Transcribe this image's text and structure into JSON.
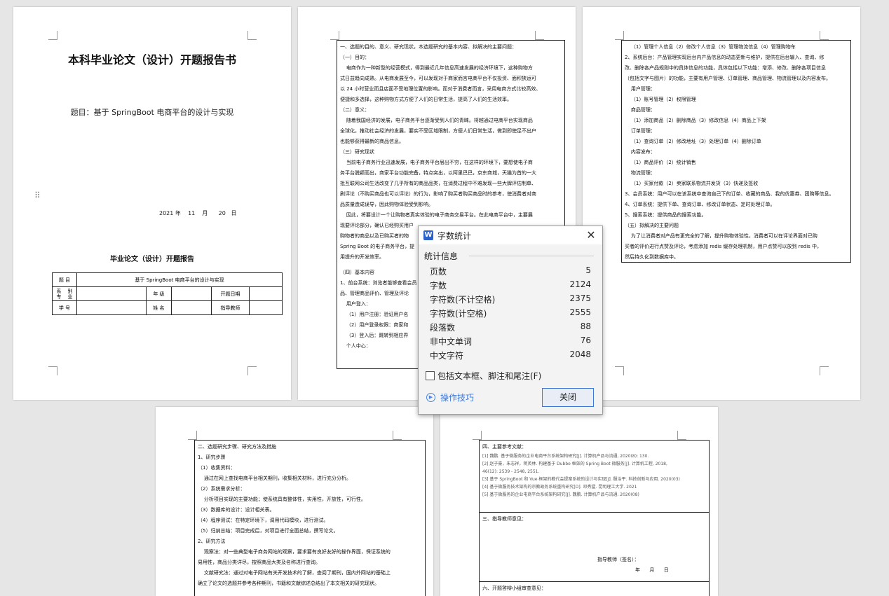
{
  "page1": {
    "title": "本科毕业论文（设计）开题报告书",
    "topic": "题目：基于 SpringBoot 电商平台的设计与实现",
    "date": "2021 年    11    月      20   日",
    "form_title": "毕业论文（设计）开题报告",
    "table": {
      "row1_label": "题    目",
      "row1_value": "基于 SpringBoot 电商平台的设计与实现",
      "row2": [
        "系    别\n专    业",
        "",
        "年    级",
        "",
        "开题日期",
        ""
      ],
      "row3": [
        "学    号",
        "",
        "姓    名",
        "",
        "指导教师",
        ""
      ]
    }
  },
  "page2": {
    "lines": [
      "一、选题的目的、意义、研究现状，本选题研究的基本内容、拟解决的主要问题：",
      "（一）目的：",
      "    电商作为一种新型的经营模式，得到最近几年信息高速发展的经济环境下，这种购物方",
      "式日益趋向成熟。从电商发展至今，可以发现对于商家而言电商平台不仅投资、面积狭运可",
      "以 24 小时营业而且店面不受地理位置的影响。而对于消费者而言，采用电商方式比较高效、",
      "便捷和多选择，这种购物方式方便了人们的日常生活，提高了人们的生活效率。",
      "（二）意义：",
      "    随着我国经济的发展，电子商务平台逐渐受到人们的青睐。将越通过电商平台实现商品",
      "全球化，推动社会经济的发展，要实不受区域限制，方便人们日常生活，做到即使足不出户",
      "也能够获得最新的商品信息。",
      "（三）研究现状",
      "    当前电子商务行业迅速发展，电子商务平台层出不穷，在这样的环境下，要想使电子商",
      "务平台脱颖而出，商家平台功能完备，特点突出，以阿里巴巴，京东商城，天猫为首的一大",
      "批互联网公司生活改变了几乎所有的商品品类，在消费过程中不难发现一些大牌评估制单、",
      "刷评论（不购买商品也可以评论）的行为，影响了购买者购买商品时的参考，使消费者对商",
      "品质量造成误导，因此购物体验受到影响。",
      "    因此，将要设计一个让购物者真实体验的电子商务交易平台。在此电商平台中，主要展",
      "现要评论部分，确认已经购买用户",
      "购物者的商品以及已购买者的物",
      "Spring Boot 的电子商务平台，提",
      "用提升的开发效率。",
      "",
      "（四）基本内容",
      "1、前台系统：浏览者能够查看会员",
      "品、管理商品评价、管理及评论",
      "    用户登入：",
      "    （1）用户注册：验证用户名",
      "    （2）用户登录权限：商家和",
      "    （3）登入后：跳转到相应界",
      "    个人中心："
    ]
  },
  "page3": {
    "lines": [
      "    （1）管理个人信息（2）修改个人信息（3）管理物流信息（4）管理购物车",
      "2、系统后台：产品管理实现后台内产品信息的动态更新与维护，提供在后台输入、查询、修",
      "改、删除各产品规则中的具体信息的功能，具体包括以下功能：增添、修改、删除各项目信息",
      "（包括文字与图片）的功能，主要有用户管理、订单管理、商品管理、物流管理以及内容发布。",
      "    用户管理：",
      "    （1）账号管理（2）权限管理",
      "    商品管理：",
      "    （1）添加商品（2）删除商品（3）修改信息（4）商品上下架",
      "    订单管理：",
      "    （1）查询订单（2）修改地址（3）处理订单（4）删除订单",
      "    内容发布：",
      "    （1）商品评价（2）统计销售",
      "    物流管理：",
      "    （1）买家付款（2）卖家联系物流并发货（3）快递及签收",
      "3、会员系统：用户可以在该系统中查询自己下的订单、收藏的商品、我的优惠券、团购等信息。",
      "4、订单系统：提供下单、查询订单、修改订单状态、定时处理订单。",
      "5、搜索系统：提供商品的搜索功能。",
      "（五）拟解决的主要问题",
      "    为了让消费者对产品有更完全的了解，提升购物体验性，消费者可以在评论界面对已购",
      "买者的评价进行点赞及评论，考虑添加 redis 缓存处理机制，用户点赞可以放到 redis 中，",
      "然后持久化到数据库中。"
    ]
  },
  "page4": {
    "lines": [
      "二、选题研究步骤、研究方法及措施",
      "1、研究步骤",
      "（1）收集资料：",
      "    通过在网上查找电商平台相关期刊，收集相关材料，进行充分分析。",
      "（2）系统需求分析：",
      "    分析项目实现的主要功能；使系统具有整体性，实用性，开放性，可行性。",
      "（3）数据库的设计：设计相关表。",
      "（4）程序测试：在特定环境下，调用代码模块，进行测试。",
      "（5）归纳总结：项目完成后，对项目进行全面总结，撰写论文。",
      "2、研究方法",
      "    观察法：对一些典型电子商务网站的观察，要求要有良好友好的操作界面，保证系统的",
      "易用性，商品分类详尽，按照商品大类及名称进行查询。",
      "    文献研究法：通过对电子网站有关开发技术的了解，查阅了期刊，国内外网站的基础上",
      "确立了论文的选题并参考各种期刊，书籍和文献综述总结出了本文相关的研究现状。"
    ]
  },
  "page5": {
    "refs_title": "四、主要参考文献：",
    "refs": [
      "[1] 魏鹏. 基于微服务的企业电商平台系统架构研究[J]. 计算机产品与流通, 2020(8): 130.",
      "[2] 赵子豪，朱志祥，蒋英林. 构建基于 Dubbo 框架的 Spring Boot 微服务[J]. 计算机工程, 2018,",
      "46(12): 2539 - 2548, 2551.",
      "[3] 基于 SpringBoot 和 Vue 框架的教代会提案系统的设计与实现[J]. 殷治平. 科技创新与应用. 2020(03)",
      "[4] 基于微服务技术架构的宗教政务系统重构研究[D]. 邓秀猛. 昆明理工大学. 2021",
      "[5] 基于微服务的企业电商平台系统架构研究[J]. 魏鹏. 计算机产品与流通. 2020(08)"
    ],
    "advisor_title": "三、指导教师意见：",
    "advisor_sign": "指导教师（签名）：",
    "advisor_date": "年      月      日",
    "group_title": "六、开题答辩小组审查意见："
  },
  "dialog": {
    "title": "字数统计",
    "app_icon": "W",
    "section": "统计信息",
    "stats": [
      {
        "label": "页数",
        "value": "5"
      },
      {
        "label": "字数",
        "value": "2124"
      },
      {
        "label": "字符数(不计空格)",
        "value": "2375"
      },
      {
        "label": "字符数(计空格)",
        "value": "2555"
      },
      {
        "label": "段落数",
        "value": "88"
      },
      {
        "label": "非中文单词",
        "value": "76"
      },
      {
        "label": "中文字符",
        "value": "2048"
      }
    ],
    "checkbox_label": "包括文本框、脚注和尾注(F)",
    "tips_label": "操作技巧",
    "close_button": "关闭",
    "close_glyph": "✕"
  },
  "colors": {
    "accent": "#3d78d8",
    "wps_blue": "#2b61c9",
    "background": "#e6e6e6"
  }
}
